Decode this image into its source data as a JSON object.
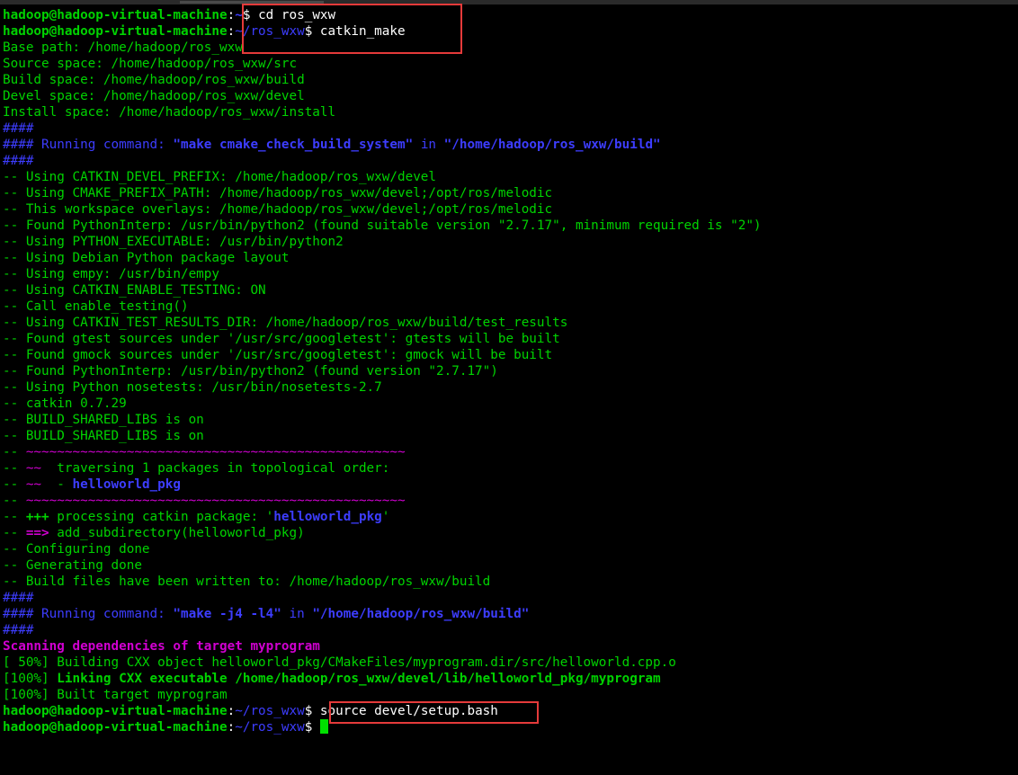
{
  "prompt": {
    "user_host": "hadoop@hadoop-virtual-machine",
    "sep": ":",
    "home": "~",
    "ros_dir": "~/ros_wxw",
    "dollar": "$ "
  },
  "commands": {
    "cd": "cd ros_wxw",
    "catkin_make": "catkin_make",
    "source": "source devel/setup.bash"
  },
  "paths": [
    "Base path: /home/hadoop/ros_wxw",
    "Source space: /home/hadoop/ros_wxw/src",
    "Build space: /home/hadoop/ros_wxw/build",
    "Devel space: /home/hadoop/ros_wxw/devel",
    "Install space: /home/hadoop/ros_wxw/install"
  ],
  "hashes": "####",
  "hash_prefix": "#### ",
  "run1": {
    "label": "Running command: ",
    "cmd": "\"make cmake_check_build_system\"",
    "in": " in ",
    "dir": "\"/home/hadoop/ros_wxw/build\""
  },
  "cmake_lines": [
    "-- Using CATKIN_DEVEL_PREFIX: /home/hadoop/ros_wxw/devel",
    "-- Using CMAKE_PREFIX_PATH: /home/hadoop/ros_wxw/devel;/opt/ros/melodic",
    "-- This workspace overlays: /home/hadoop/ros_wxw/devel;/opt/ros/melodic",
    "-- Found PythonInterp: /usr/bin/python2 (found suitable version \"2.7.17\", minimum required is \"2\")",
    "-- Using PYTHON_EXECUTABLE: /usr/bin/python2",
    "-- Using Debian Python package layout",
    "-- Using empy: /usr/bin/empy",
    "-- Using CATKIN_ENABLE_TESTING: ON",
    "-- Call enable_testing()",
    "-- Using CATKIN_TEST_RESULTS_DIR: /home/hadoop/ros_wxw/build/test_results",
    "-- Found gtest sources under '/usr/src/googletest': gtests will be built",
    "-- Found gmock sources under '/usr/src/googletest': gmock will be built",
    "-- Found PythonInterp: /usr/bin/python2 (found version \"2.7.17\")",
    "-- Using Python nosetests: /usr/bin/nosetests-2.7",
    "-- catkin 0.7.29",
    "-- BUILD_SHARED_LIBS is on",
    "-- BUILD_SHARED_LIBS is on"
  ],
  "dash_prefix": "-- ",
  "tilde_rule": "~~~~~~~~~~~~~~~~~~~~~~~~~~~~~~~~~~~~~~~~~~~~~~~~~",
  "tilde_short": "~~",
  "traversing": "  traversing 1 packages in topological order:",
  "pkg_bullet": "  - ",
  "pkg_name": "helloworld_pkg",
  "processing": {
    "plus": "+++",
    "text": " processing catkin package: '",
    "pkg": "helloworld_pkg",
    "end": "'"
  },
  "subdir": {
    "arrow": "==>",
    "text": " add_subdirectory(helloworld_pkg)"
  },
  "gen_lines": [
    "-- Configuring done",
    "-- Generating done",
    "-- Build files have been written to: /home/hadoop/ros_wxw/build"
  ],
  "run2": {
    "label": "Running command: ",
    "cmd": "\"make -j4 -l4\"",
    "in": " in ",
    "dir": "\"/home/hadoop/ros_wxw/build\""
  },
  "scanning": "Scanning dependencies of target myprogram",
  "build_lines": {
    "b1": "[ 50%] Building CXX object helloworld_pkg/CMakeFiles/myprogram.dir/src/helloworld.cpp.o",
    "b2_prefix": "[100%] ",
    "b2": "Linking CXX executable /home/hadoop/ros_wxw/devel/lib/helloworld_pkg/myprogram",
    "b3": "[100%] Built target myprogram"
  },
  "colors": {
    "green": "#00d300",
    "blue": "#3d3dff",
    "magenta": "#d000d0",
    "highlight": "#e53a3a",
    "background": "#000000"
  }
}
